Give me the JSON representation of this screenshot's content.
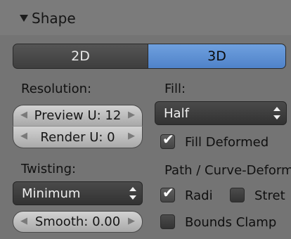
{
  "panel": {
    "title": "Shape"
  },
  "dimensions": {
    "options": [
      "2D",
      "3D"
    ],
    "selected": "3D"
  },
  "resolution": {
    "label": "Resolution:",
    "preview_u": "Preview U: 12",
    "render_u": "Render U: 0"
  },
  "twisting": {
    "label": "Twisting:",
    "mode": "Minimum",
    "smooth": "Smooth: 0.00"
  },
  "fill": {
    "label": "Fill:",
    "mode": "Half",
    "fill_deformed": {
      "label": "Fill Deformed",
      "checked": true
    }
  },
  "path_deform": {
    "label": "Path / Curve-Deform",
    "radius": {
      "label": "Radi",
      "checked": true
    },
    "stretch": {
      "label": "Stret",
      "checked": false
    },
    "bounds_clamp": {
      "label": "Bounds Clamp",
      "checked": false
    }
  },
  "colors": {
    "accent": "#5a8cd2",
    "panel_bg": "#747474"
  }
}
